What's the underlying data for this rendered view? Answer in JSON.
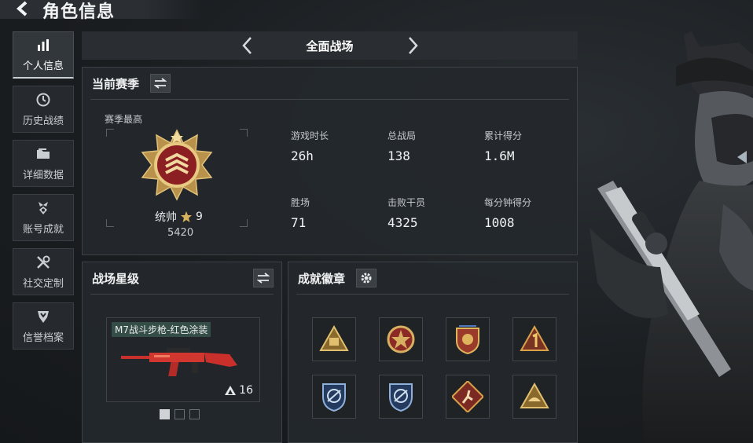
{
  "header": {
    "title": "角色信息"
  },
  "sidebar": {
    "items": [
      {
        "label": "个人信息",
        "icon": "bar-chart-icon",
        "active": true
      },
      {
        "label": "历史战绩",
        "icon": "history-clock-icon",
        "active": false
      },
      {
        "label": "详细数据",
        "icon": "folder-icon",
        "active": false
      },
      {
        "label": "账号成就",
        "icon": "medal-icon",
        "active": false
      },
      {
        "label": "社交定制",
        "icon": "tools-icon",
        "active": false
      },
      {
        "label": "信誉档案",
        "icon": "reputation-icon",
        "active": false
      }
    ]
  },
  "mode": {
    "title": "全面战场"
  },
  "season": {
    "title": "当前赛季",
    "best_label": "赛季最高",
    "rank_name": "统帅",
    "rank_stars": "9",
    "rank_score": "5420",
    "stats": [
      {
        "label": "游戏时长",
        "value": "26h"
      },
      {
        "label": "总战局",
        "value": "138"
      },
      {
        "label": "累计得分",
        "value": "1.6M"
      },
      {
        "label": "胜场",
        "value": "71"
      },
      {
        "label": "击败干员",
        "value": "4325"
      },
      {
        "label": "每分钟得分",
        "value": "1008"
      }
    ]
  },
  "battlefield_star": {
    "title": "战场星级",
    "weapon_name": "M7战斗步枪-红色涂装",
    "weapon_level": "16",
    "pages": 3,
    "current_page": 1
  },
  "achievements": {
    "title": "成就徽章",
    "badges": [
      "gold-triangle-badge-icon",
      "red-star-round-badge-icon",
      "gold-shield-badge-icon",
      "triangle-number-one-badge-icon",
      "blue-shield-badge-icon",
      "blue-shield-badge-icon",
      "red-runner-badge-icon",
      "gold-triangle-hat-badge-icon"
    ]
  },
  "colors": {
    "accent_gold": "#c9a24a",
    "panel_bg": "#24282c",
    "rank_red": "#a52a2a"
  }
}
